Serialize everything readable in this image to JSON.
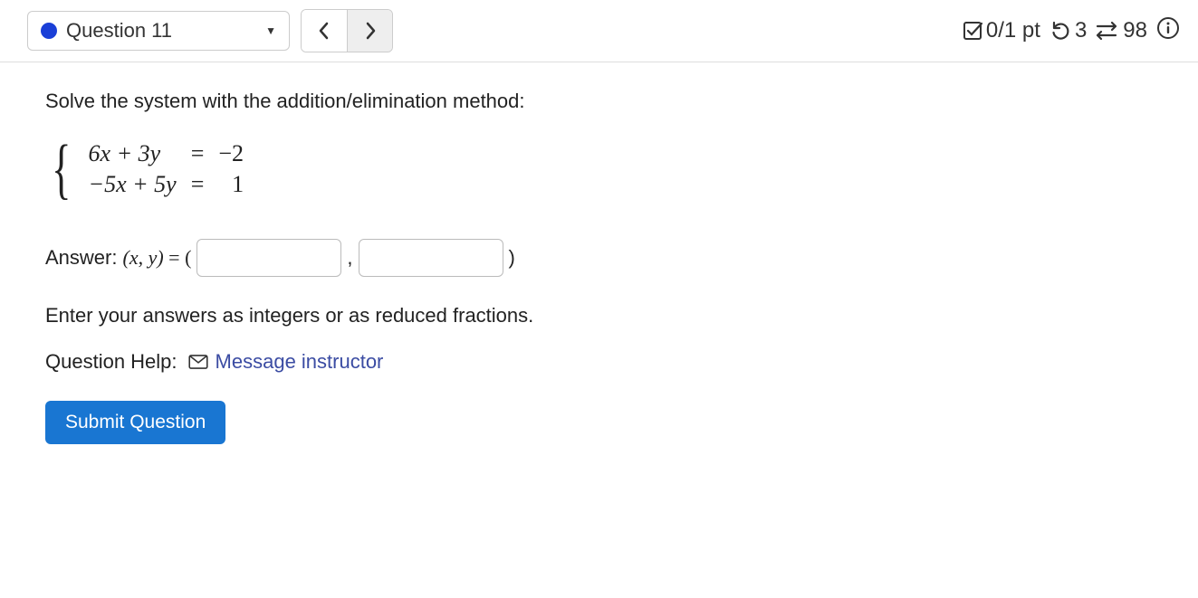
{
  "header": {
    "question_label": "Question 11",
    "score": "0/1 pt",
    "retries": "3",
    "attempts_remaining": "98"
  },
  "question": {
    "prompt": "Solve the system with the addition/elimination method:",
    "eq1_lhs": "6x + 3y",
    "eq1_rhs": "−2",
    "eq2_lhs": "−5x + 5y",
    "eq2_rhs": "1",
    "answer_label": "Answer:",
    "answer_var": "(x, y) = (",
    "answer_close": ")",
    "hint": "Enter your answers as integers or as reduced fractions.",
    "help_label": "Question Help:",
    "msg_instructor": "Message instructor",
    "submit": "Submit Question"
  }
}
